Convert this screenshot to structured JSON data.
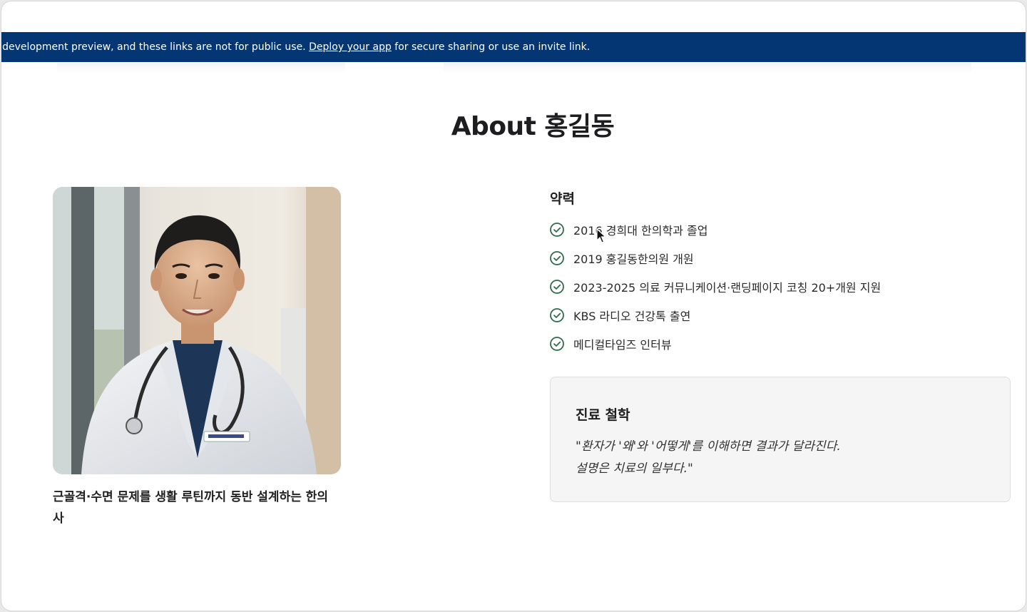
{
  "banner": {
    "text_before": "nporary development preview, and these links are not for public use. ",
    "link": "Deploy your app",
    "text_after": " for secure sharing or use an invite link."
  },
  "about": {
    "title": "About 홍길동",
    "caption": "근골격·수면 문제를 생활 루틴까지 동반 설계하는 한의사"
  },
  "career": {
    "title": "약력",
    "items": [
      "2016 경희대 한의학과 졸업",
      "2019 홍길동한의원 개원",
      "2023-2025 의료 커뮤니케이션·랜딩페이지 코칭 20+개원 지원",
      "KBS 라디오 건강톡 출연",
      "메디컬타임즈 인터뷰"
    ]
  },
  "philosophy": {
    "title": "진료 철학",
    "quote_line1": "\"환자가 '왜'와 '어떻게'를 이해하면 결과가 달라진다.",
    "quote_line2": "설명은 치료의 일부다.\""
  },
  "colors": {
    "banner_bg": "#043674",
    "check_green": "#2f6b4f",
    "card_bg": "#f4f5f4"
  },
  "icons": {
    "check": "check-circle-icon",
    "cursor": "mouse-cursor-icon"
  }
}
